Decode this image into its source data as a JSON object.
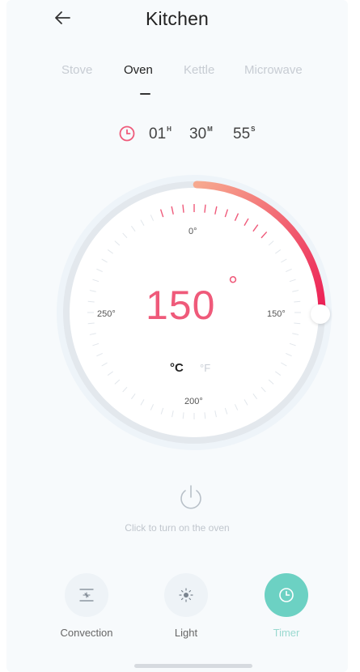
{
  "header": {
    "title": "Kitchen"
  },
  "tabs": [
    {
      "label": "Stove",
      "active": false
    },
    {
      "label": "Oven",
      "active": true
    },
    {
      "label": "Kettle",
      "active": false
    },
    {
      "label": "Microwave",
      "active": false
    }
  ],
  "timer": {
    "hours": "01",
    "hours_unit": "H",
    "minutes": "30",
    "minutes_unit": "M",
    "seconds": "55",
    "seconds_unit": "S"
  },
  "dial": {
    "temperature": "150",
    "degree_symbol": "°",
    "scale_labels": {
      "top": "0°",
      "left": "250°",
      "right": "150°",
      "bottom": "200°"
    },
    "unit_celsius": "°C",
    "unit_fahrenheit": "°F",
    "progress": 0.25,
    "accent_start": "#f7a98f",
    "accent_end": "#ec1e55"
  },
  "power": {
    "hint": "Click to turn on the oven"
  },
  "actions": [
    {
      "label": "Convection",
      "icon": "convection-icon",
      "active": false
    },
    {
      "label": "Light",
      "icon": "light-icon",
      "active": false
    },
    {
      "label": "Timer",
      "icon": "clock-icon",
      "active": true
    }
  ],
  "colors": {
    "accent": "#ef5a7a",
    "active_action": "#6cd1c3"
  }
}
